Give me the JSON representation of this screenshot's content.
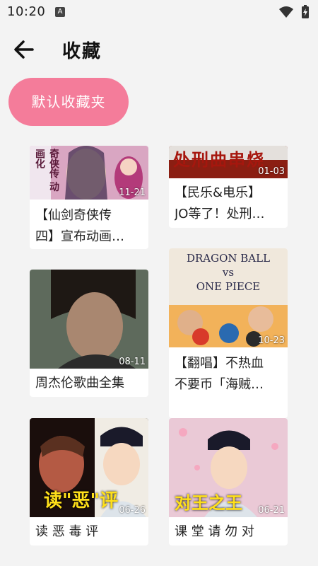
{
  "status_bar": {
    "time": "10:20",
    "notification_icon": "a-icon",
    "icons": [
      "wifi-icon",
      "battery-charging-icon"
    ]
  },
  "header": {
    "back_icon": "arrow-left-icon",
    "title": "收藏"
  },
  "folder": {
    "label": "默认收藏夹",
    "color": "#f47c9a"
  },
  "videos": [
    {
      "title_line1": "【仙剑奇侠传",
      "title_line2": "四】宣布动画…",
      "date": "11-21",
      "thumb_text": "奇侠传 动画化"
    },
    {
      "title_line1": "【民乐&电乐】",
      "title_line2": "JO等了！处刑…",
      "date": "01-03",
      "thumb_text": "处刑曲串烧"
    },
    {
      "title_line1": "周杰伦歌曲全集",
      "title_line2": "",
      "date": "08-11",
      "thumb_text": ""
    },
    {
      "title_line1": "【翻唱】不热血",
      "title_line2": "不要币「海贼…",
      "date": "10-23",
      "thumb_text_1": "DRAGON BALL",
      "thumb_text_2": "vs",
      "thumb_text_3": "ONE PIECE"
    },
    {
      "title_line1": "读 恶 毒 评",
      "title_line2": "",
      "date": "06-26",
      "thumb_text": "读\"恶\"评"
    },
    {
      "title_line1": "课 堂 请 勿 对",
      "title_line2": "",
      "date": "06-21",
      "thumb_text": "对王之王"
    }
  ]
}
